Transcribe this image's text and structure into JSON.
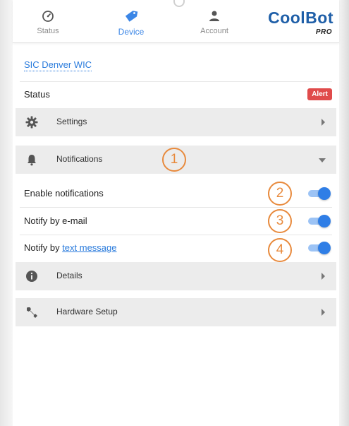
{
  "nav": {
    "tabs": [
      {
        "label": "Status",
        "icon": "gauge-icon",
        "active": false
      },
      {
        "label": "Device",
        "icon": "tag-icon",
        "active": true
      },
      {
        "label": "Account",
        "icon": "person-icon",
        "active": false
      }
    ],
    "logo": {
      "name": "CoolBot",
      "sub": "PRO"
    }
  },
  "location": {
    "name": "SIC Denver WIC"
  },
  "status": {
    "label": "Status",
    "badge": "Alert"
  },
  "sections": [
    {
      "label": "Settings",
      "icon": "gear-icon",
      "expanded": false
    },
    {
      "label": "Notifications",
      "icon": "bell-icon",
      "expanded": true
    },
    {
      "label": "Details",
      "icon": "info-icon",
      "expanded": false
    },
    {
      "label": "Hardware Setup",
      "icon": "wrench-icon",
      "expanded": false
    }
  ],
  "notifications": {
    "enable": {
      "label": "Enable notifications",
      "on": true
    },
    "email": {
      "label": "Notify by e-mail",
      "on": true
    },
    "text": {
      "label_prefix": "Notify by ",
      "link": "text message",
      "on": true
    }
  },
  "callouts": [
    "1",
    "2",
    "3",
    "4"
  ],
  "colors": {
    "accent": "#2f7ee6",
    "alert": "#e04b4b",
    "callout": "#e88a3d",
    "section_bg": "#ececec"
  }
}
